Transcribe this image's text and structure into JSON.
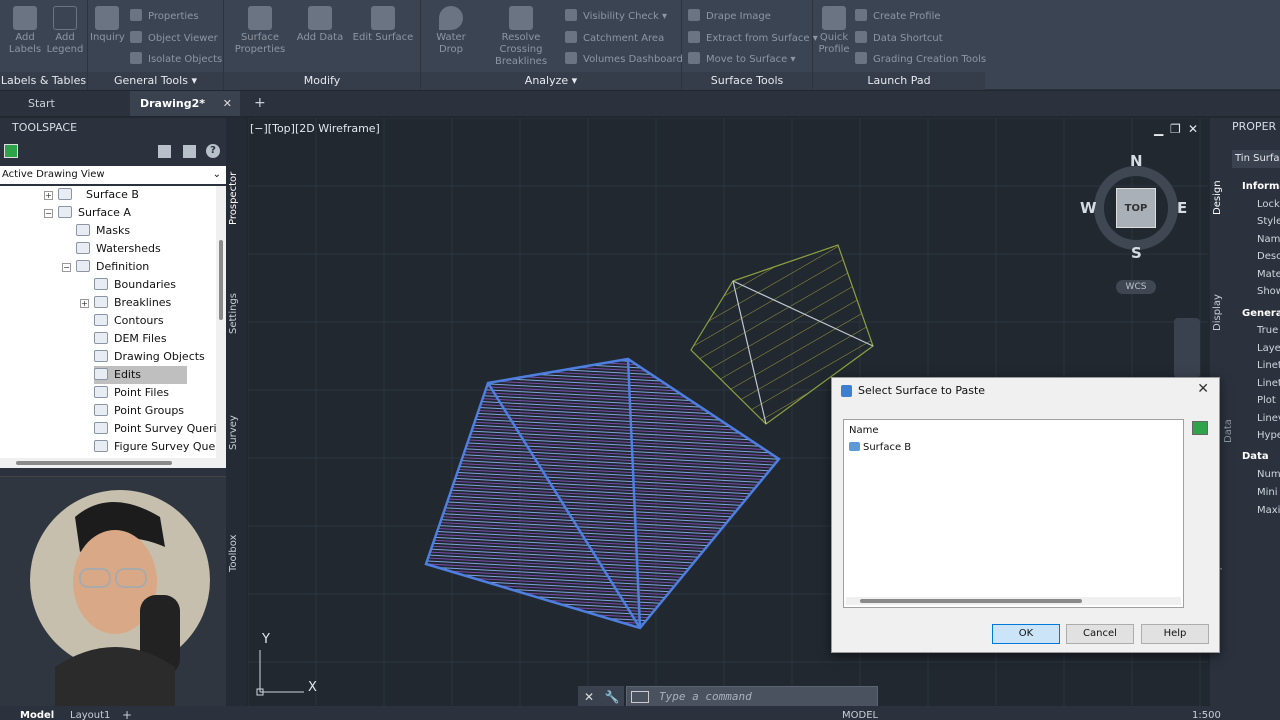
{
  "ribbon": {
    "panels": {
      "labels_tables": "Labels & Tables",
      "general_tools": "General Tools",
      "modify": "Modify",
      "analyze": "Analyze",
      "surface_tools": "Surface Tools",
      "launch_pad": "Launch Pad"
    },
    "buttons": {
      "add_labels": "Add Labels",
      "add_legend": "Add Legend",
      "inquiry": "Inquiry",
      "properties": "Properties",
      "object_viewer": "Object Viewer",
      "isolate_objects": "Isolate Objects",
      "surface_properties": "Surface Properties",
      "add_data": "Add Data",
      "edit_surface": "Edit Surface",
      "water_drop": "Water Drop",
      "resolve_crossing": "Resolve Crossing Breaklines",
      "visibility_check": "Visibility Check",
      "catchment_area": "Catchment Area",
      "volumes_dashboard": "Volumes Dashboard",
      "drape_image": "Drape Image",
      "extract_from_surface": "Extract from Surface",
      "move_to_surface": "Move to Surface",
      "quick_profile": "Quick Profile",
      "create_profile": "Create Profile",
      "data_shortcut": "Data Shortcut",
      "grading_creation_tools": "Grading Creation Tools"
    }
  },
  "tabs": {
    "start": "Start",
    "drawing": "Drawing2*",
    "close": "✕",
    "add": "+"
  },
  "toolspace": {
    "title": "TOOLSPACE",
    "view_dropdown": "Active Drawing View",
    "tree": {
      "surface_b": "Surface B",
      "surface_a": "Surface A",
      "masks": "Masks",
      "watersheds": "Watersheds",
      "definition": "Definition",
      "boundaries": "Boundaries",
      "breaklines": "Breaklines",
      "contours": "Contours",
      "dem_files": "DEM Files",
      "drawing_objects": "Drawing Objects",
      "edits": "Edits",
      "point_files": "Point Files",
      "point_groups": "Point Groups",
      "point_survey_queries": "Point Survey Queri...",
      "figure_survey_queries": "Figure Survey Que..."
    },
    "vtabs": {
      "prospector": "Prospector",
      "settings": "Settings",
      "survey": "Survey",
      "toolbox": "Toolbox"
    }
  },
  "viewport": {
    "label": "[−][Top][2D Wireframe]",
    "viewcube": {
      "n": "N",
      "s": "S",
      "e": "E",
      "w": "W",
      "face": "TOP",
      "wcs": "WCS"
    },
    "ucs": {
      "x": "X",
      "y": "Y"
    }
  },
  "properties_panel": {
    "title": "PROPER",
    "dropdown": "Tin Surface",
    "vtabs": {
      "design": "Design",
      "display": "Display",
      "extended": "Extended Data",
      "object_class": "Object Class"
    },
    "sections": {
      "information": "Informa",
      "general": "General",
      "data": "Data"
    },
    "rows": [
      "Lock",
      "Style",
      "Nam",
      "Desc",
      "Mate",
      "Show",
      "True",
      "Laye",
      "Linet",
      "Linet",
      "Plot",
      "Linev",
      "Hype",
      "Num",
      "Mini",
      "Maxi"
    ]
  },
  "command": {
    "placeholder": "Type a command"
  },
  "status": {
    "model": "Model",
    "layout1": "Layout1",
    "model_caps": "MODEL",
    "scale": "1:500"
  },
  "dialog": {
    "title": "Select Surface to Paste",
    "column_header": "Name",
    "items": [
      "Surface B"
    ],
    "ok": "OK",
    "cancel": "Cancel",
    "help": "Help"
  }
}
